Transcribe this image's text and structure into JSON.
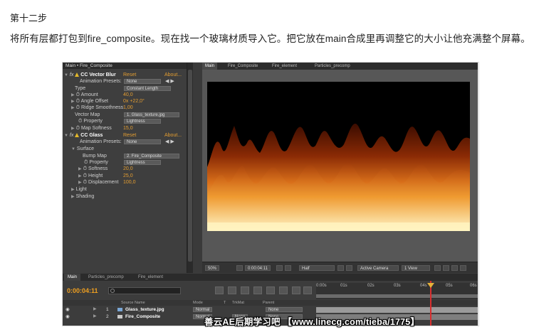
{
  "article": {
    "step_title": "第十二步",
    "paragraph": "将所有层都打包到fire_composite。现在找一个玻璃材质导入它。把它放在main合成里再调整它的大小让他充满整个屏幕。"
  },
  "effects_panel": {
    "breadcrumb": "Main • Fire_Composite",
    "vector_blur": {
      "fx": "fx",
      "name": "CC Vector Blur",
      "reset": "Reset",
      "about": "About...",
      "presets_label": "Animation Presets:",
      "presets_value": "None",
      "type_label": "Type",
      "type_value": "Constant Length",
      "amount_label": "Amount",
      "amount_value": "40,0",
      "angle_label": "Angle Offset",
      "angle_value": "0x +22,0°",
      "ridge_label": "Ridge Smoothness",
      "ridge_value": "1,00",
      "vector_map_label": "Vector Map",
      "vector_map_value": "1. Glass_texture.jpg",
      "property_label": "Property",
      "property_value": "Lightness",
      "softness_label": "Map Softness",
      "softness_value": "15,0"
    },
    "glass": {
      "fx": "fx",
      "name": "CC Glass",
      "reset": "Reset",
      "about": "About...",
      "presets_label": "Animation Presets:",
      "presets_value": "None",
      "surface_label": "Surface",
      "bump_label": "Bump Map",
      "bump_value": "2. Fire_Composite",
      "property_label": "Property",
      "property_value": "Lightness",
      "softness_label": "Softness",
      "softness_value": "20,0",
      "height_label": "Height",
      "height_value": "25,0",
      "displacement_label": "Displacement",
      "displacement_value": "100,0",
      "light_label": "Light",
      "shading_label": "Shading"
    }
  },
  "comp_viewer": {
    "tabs": [
      "Main",
      "Fire_Composite",
      "Fire_element",
      "Particles_precomp"
    ],
    "toolbar": {
      "zoom": "50%",
      "timecode": "0:00:04:11",
      "resolution": "Half",
      "camera": "Active Camera",
      "views": "1 View"
    }
  },
  "timeline": {
    "tabs": [
      "Main",
      "Particles_precomp",
      "Fire_element"
    ],
    "timecode": "0:00:04:11",
    "ruler": [
      "0:00s",
      "01s",
      "02s",
      "03s",
      "04s",
      "05s",
      "06s"
    ],
    "columns": {
      "source": "Source Name",
      "mode": "Mode",
      "t": "T",
      "trkmat": "TrkMat",
      "parent": "Parent"
    },
    "layers": [
      {
        "num": "1",
        "name": "Glass_texture.jpg",
        "mode": "Normal",
        "trkmat": "",
        "parent": "None"
      },
      {
        "num": "2",
        "name": "Fire_Composite",
        "mode": "Normal",
        "trkmat": "None",
        "parent": "None"
      }
    ]
  },
  "watermark": "善云AE后期学习吧 【www.linecg.com/tieba/1775】",
  "colors": {
    "accent_orange": "#e39d31",
    "timecode_orange": "#f0a020",
    "cti_red": "#d92f2f",
    "panel_bg": "#3e3e3e"
  }
}
